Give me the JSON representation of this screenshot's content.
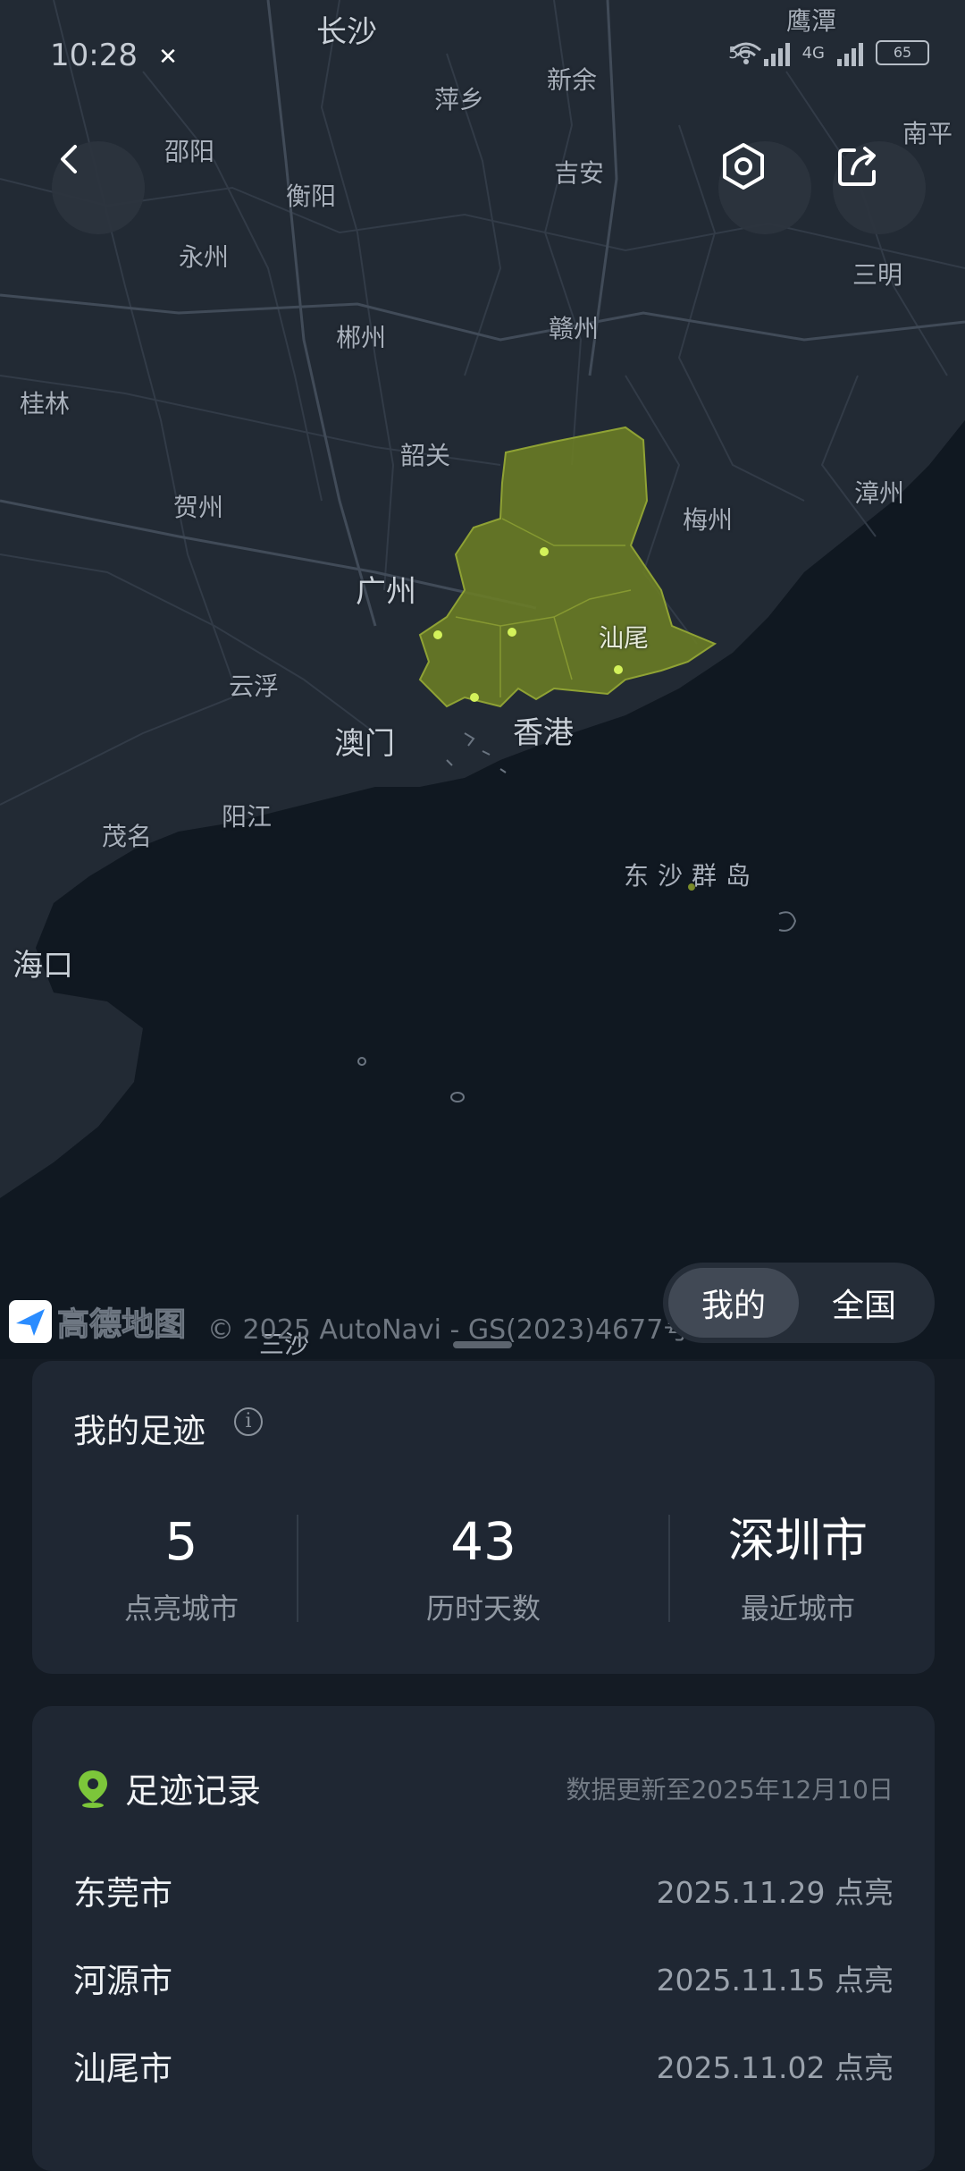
{
  "status_bar": {
    "time": "10:28",
    "net1": "5G",
    "net2": "4G",
    "battery": "65"
  },
  "map": {
    "labels": {
      "changsha": "长沙",
      "yingtan": "鹰潭",
      "xinyu": "新余",
      "pingxiang": "萍乡",
      "nanping": "南平",
      "shaoyang": "邵阳",
      "hengyang": "衡阳",
      "jian": "吉安",
      "sanming": "三明",
      "yongzhou": "永州",
      "chenzhou": "郴州",
      "ganzhou": "赣州",
      "guilin": "桂林",
      "shaoguan": "韶关",
      "zhangzhou": "漳州",
      "hezhou": "贺州",
      "meizhou": "梅州",
      "guangzhou": "广州",
      "shanwei": "汕尾",
      "yunfu": "云浮",
      "macau": "澳门",
      "hongkong": "香港",
      "maoming": "茂名",
      "yangjiang": "阳江",
      "dongsha": "东沙群岛",
      "haikou": "海口",
      "sansha": "三沙"
    },
    "attribution": {
      "logo_text": "高德地图",
      "copyright": "© 2025 AutoNavi - GS(2023)4677号"
    },
    "highlight_color": "#6b7d24",
    "dot_color": "#d3f25a"
  },
  "toggle": {
    "mine": "我的",
    "all": "全国"
  },
  "footprint": {
    "title": "我的足迹",
    "stats": [
      {
        "value": "5",
        "label": "点亮城市"
      },
      {
        "value": "43",
        "label": "历时天数"
      },
      {
        "value": "深圳市",
        "label": "最近城市"
      }
    ]
  },
  "records": {
    "title": "足迹记录",
    "update_note": "数据更新至2025年12月10日",
    "items": [
      {
        "city": "东莞市",
        "date": "2025.11.29 点亮"
      },
      {
        "city": "河源市",
        "date": "2025.11.15 点亮"
      },
      {
        "city": "汕尾市",
        "date": "2025.11.02 点亮"
      }
    ]
  }
}
